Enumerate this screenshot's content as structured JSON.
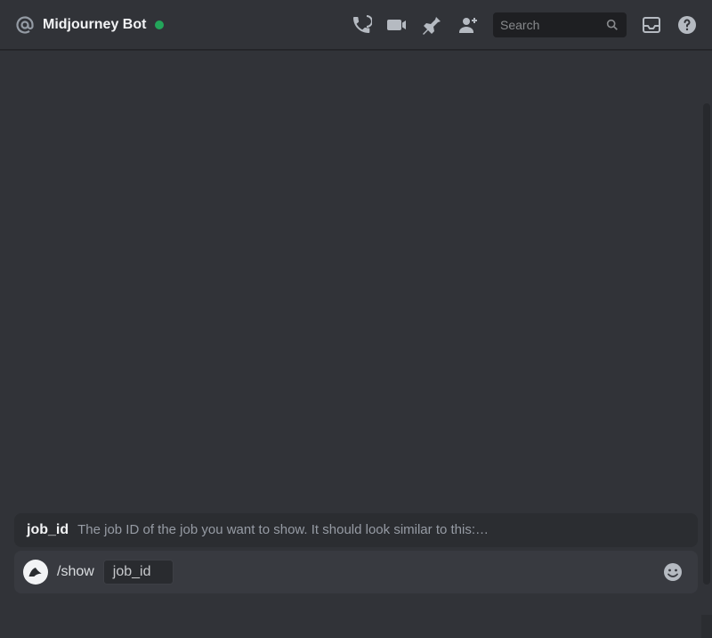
{
  "header": {
    "title": "Midjourney Bot",
    "search_placeholder": "Search"
  },
  "suggestion": {
    "param": "job_id",
    "description": "The job ID of the job you want to show. It should look similar to this:…"
  },
  "input": {
    "command": "/show",
    "param_chip": "job_id"
  }
}
